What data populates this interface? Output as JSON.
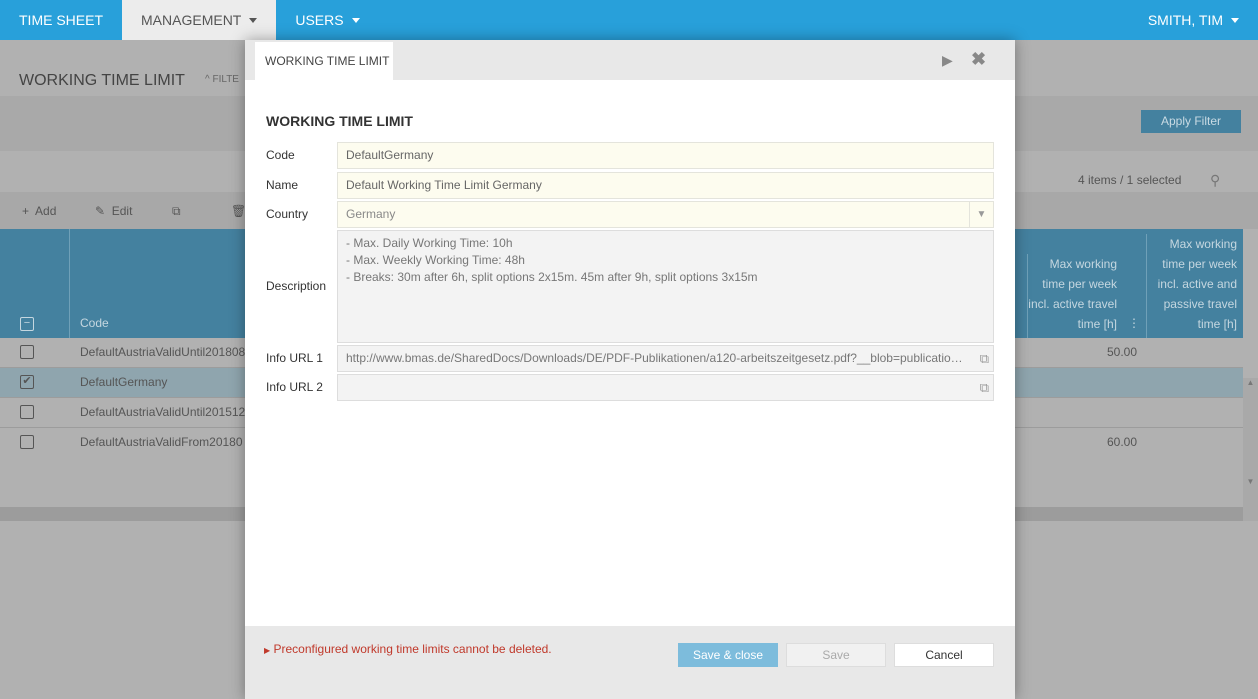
{
  "nav": {
    "items": [
      {
        "label": "TIME SHEET"
      },
      {
        "label": "MANAGEMENT"
      },
      {
        "label": "USERS"
      }
    ],
    "user": "SMITH, TIM"
  },
  "page": {
    "title": "WORKING TIME LIMIT",
    "filter_label": "FILTE",
    "apply_filter": "Apply Filter",
    "count": "4 items / 1 selected",
    "toolbar": {
      "add": "Add",
      "edit": "Edit"
    },
    "columns": {
      "code": "Code",
      "col_week_active": "Max working time per week incl. active travel time [h]",
      "col_week_passive": "Max working time per week incl. active and passive travel time [h]"
    },
    "rows": [
      {
        "code": "DefaultAustriaValidUntil201808",
        "value": "50.00",
        "selected": false
      },
      {
        "code": "DefaultGermany",
        "value": "",
        "selected": true
      },
      {
        "code": "DefaultAustriaValidUntil201512",
        "value": "",
        "selected": false
      },
      {
        "code": "DefaultAustriaValidFrom20180",
        "value": "60.00",
        "selected": false
      }
    ]
  },
  "modal": {
    "tab": "WORKING TIME LIMIT",
    "title": "WORKING TIME LIMIT",
    "fields": {
      "code_label": "Code",
      "code": "DefaultGermany",
      "name_label": "Name",
      "name": "Default Working Time Limit Germany",
      "country_label": "Country",
      "country": "Germany",
      "description_label": "Description",
      "description": "- Max. Daily Working Time: 10h\n- Max. Weekly Working Time: 48h\n- Breaks: 30m after 6h, split options 2x15m. 45m after 9h, split options 3x15m",
      "url1_label": "Info URL 1",
      "url1": "http://www.bmas.de/SharedDocs/Downloads/DE/PDF-Publikationen/a120-arbeitszeitgesetz.pdf?__blob=publicatio…",
      "url2_label": "Info URL 2",
      "url2": ""
    },
    "warning": "Preconfigured working time limits cannot be deleted.",
    "save_close": "Save & close",
    "save": "Save",
    "cancel": "Cancel"
  },
  "colors": {
    "nav": "#28a0da",
    "accent": "#7dbcdc",
    "warning": "#c0392b"
  }
}
